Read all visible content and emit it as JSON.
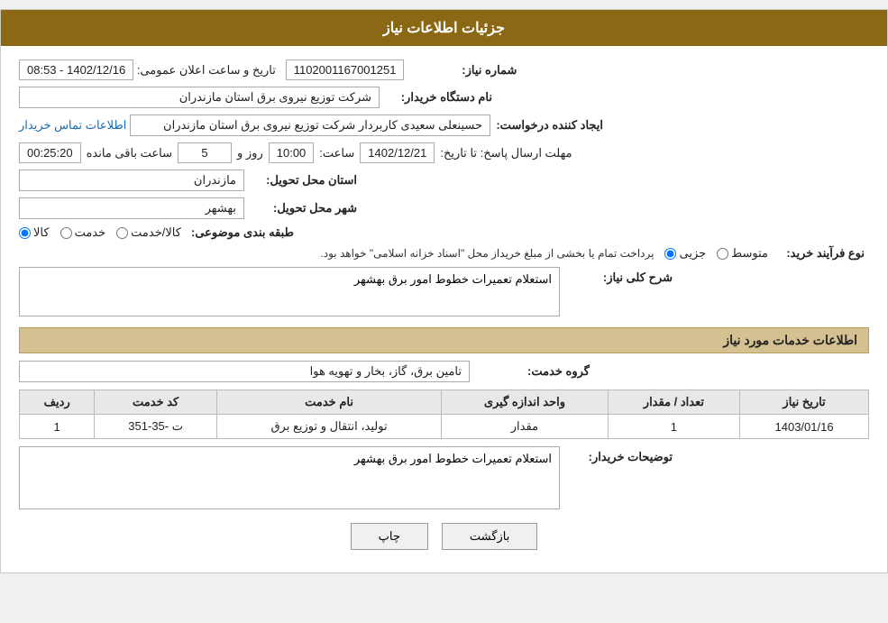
{
  "header": {
    "title": "جزئیات اطلاعات نیاز"
  },
  "fields": {
    "need_number_label": "شماره نیاز:",
    "need_number_value": "1102001167001251",
    "announce_date_label": "تاریخ و ساعت اعلان عمومی:",
    "announce_date_value": "1402/12/16 - 08:53",
    "buyer_org_label": "نام دستگاه خریدار:",
    "buyer_org_value": "شرکت توزیع نیروی برق استان مازندران",
    "creator_label": "ایجاد کننده درخواست:",
    "creator_value": "حسینعلی سعیدی کاربردار شرکت توزیع نیروی برق استان مازندران",
    "contact_link": "اطلاعات تماس خریدار",
    "deadline_label": "مهلت ارسال پاسخ: تا تاریخ:",
    "deadline_date": "1402/12/21",
    "deadline_time_label": "ساعت:",
    "deadline_time": "10:00",
    "deadline_days_label": "روز و",
    "deadline_days": "5",
    "deadline_remaining_label": "ساعت باقی مانده",
    "deadline_remaining": "00:25:20",
    "province_label": "استان محل تحویل:",
    "province_value": "مازندران",
    "city_label": "شهر محل تحویل:",
    "city_value": "بهشهر",
    "category_label": "طبقه بندی موضوعی:",
    "category_radio_1": "کالا",
    "category_radio_2": "خدمت",
    "category_radio_3": "کالا/خدمت",
    "purchase_type_label": "نوع فرآیند خرید:",
    "purchase_type_radio_1": "جزیی",
    "purchase_type_radio_2": "متوسط",
    "purchase_type_note": "پرداخت تمام یا بخشی از مبلغ خریداز محل \"اسناد خزانه اسلامی\" خواهد بود.",
    "need_desc_label": "شرح کلی نیاز:",
    "need_desc_value": "استعلام تعمیرات خطوط امور برق بهشهر",
    "services_section_title": "اطلاعات خدمات مورد نیاز",
    "group_service_label": "گروه خدمت:",
    "group_service_value": "تامین برق، گاز، بخار و تهویه هوا",
    "table_headers": {
      "row_num": "ردیف",
      "service_code": "کد خدمت",
      "service_name": "نام خدمت",
      "unit": "واحد اندازه گیری",
      "quantity": "تعداد / مقدار",
      "need_date": "تاریخ نیاز"
    },
    "table_rows": [
      {
        "row_num": "1",
        "service_code": "ت -35-351",
        "service_name": "تولید، انتقال و توزیع برق",
        "unit": "مقدار",
        "quantity": "1",
        "need_date": "1403/01/16"
      }
    ],
    "buyer_notes_label": "توضیحات خریدار:",
    "buyer_notes_value": "استعلام تعمیرات خطوط امور برق بهشهر"
  },
  "buttons": {
    "print": "چاپ",
    "back": "بازگشت"
  }
}
